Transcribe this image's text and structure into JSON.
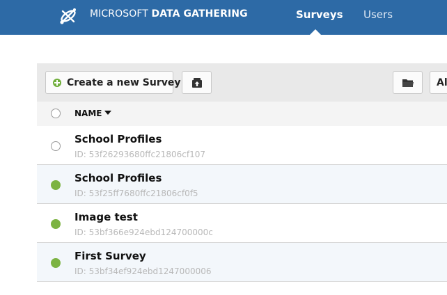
{
  "header": {
    "brand_part1": "MICROSOFT",
    "brand_part2": "DATA GATHERING",
    "nav": [
      {
        "label": "Surveys",
        "active": true
      },
      {
        "label": "Users",
        "active": false
      }
    ],
    "background": "#2d6aa6"
  },
  "toolbar": {
    "create_label": "Create a new Survey",
    "import_icon": "upload-box-icon",
    "folder_icon": "folder-icon",
    "all_label": "Al"
  },
  "table": {
    "columns": [
      {
        "label": "NAME",
        "sort": "desc"
      }
    ],
    "rows": [
      {
        "name": "School Profiles",
        "id": "ID: 53f26293680ffc21806cf107",
        "status": "inactive"
      },
      {
        "name": "School Profiles",
        "id": "ID: 53f25ff7680ffc21806cf0f5",
        "status": "active"
      },
      {
        "name": "Image test",
        "id": "ID: 53bf366e924ebd124700000c",
        "status": "active"
      },
      {
        "name": "First Survey",
        "id": "ID: 53bf34ef924ebd1247000006",
        "status": "active"
      }
    ]
  },
  "colors": {
    "active_status": "#7cb342",
    "create_plus": "#6fae3a"
  }
}
